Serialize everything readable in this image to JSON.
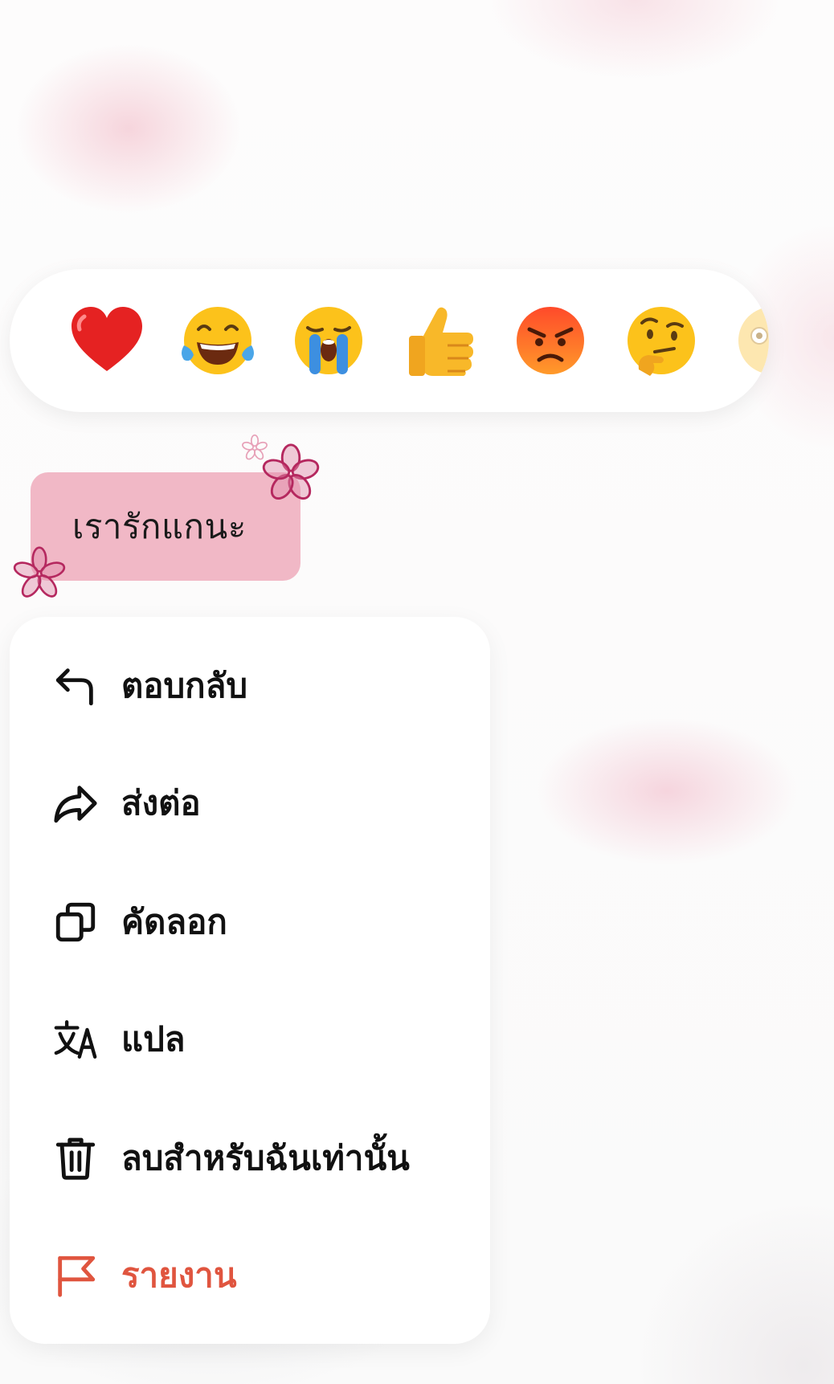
{
  "reactions": [
    {
      "icon": "heart-icon"
    },
    {
      "icon": "tears-of-joy-emoji"
    },
    {
      "icon": "crying-emoji"
    },
    {
      "icon": "thumbs-up-emoji"
    },
    {
      "icon": "angry-emoji"
    },
    {
      "icon": "thinking-emoji"
    },
    {
      "icon": "astonished-emoji"
    }
  ],
  "message": {
    "text": "เรารักแกนะ"
  },
  "menu": {
    "items": [
      {
        "label": "ตอบกลับ",
        "icon": "reply-icon"
      },
      {
        "label": "ส่งต่อ",
        "icon": "forward-icon"
      },
      {
        "label": "คัดลอก",
        "icon": "copy-icon"
      },
      {
        "label": "แปล",
        "icon": "translate-icon"
      },
      {
        "label": "ลบสำหรับฉันเท่านั้น",
        "icon": "trash-icon"
      },
      {
        "label": "รายงาน",
        "icon": "flag-icon"
      }
    ]
  },
  "colors": {
    "bubble": "#f1b8c6",
    "danger": "#e0553f",
    "text": "#111111",
    "surface": "#ffffff"
  }
}
